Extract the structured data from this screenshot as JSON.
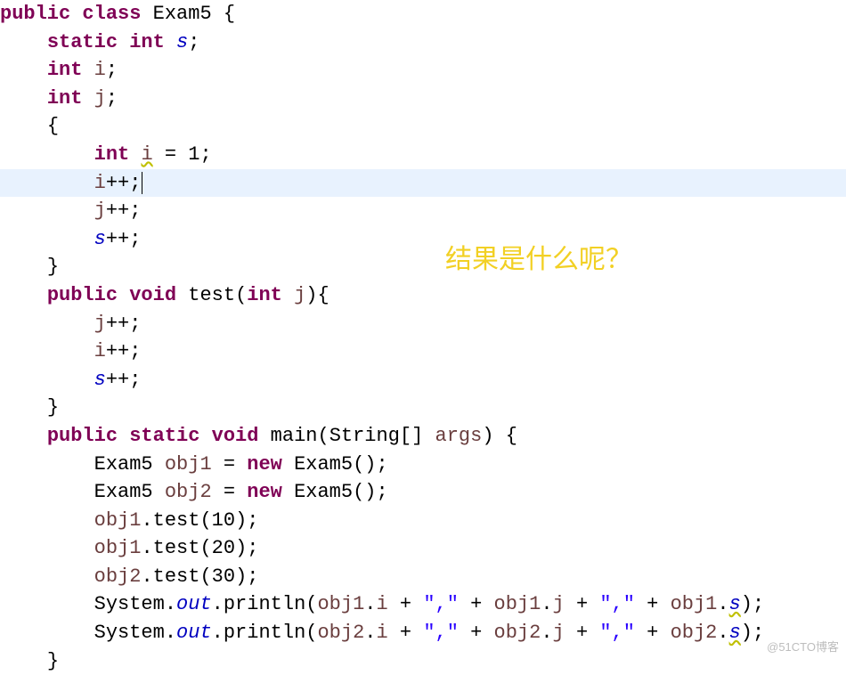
{
  "code": {
    "l1_public": "public",
    "l1_class": "class",
    "l1_name": "Exam5",
    "l2_static": "static",
    "l2_int": "int",
    "l2_s": "s",
    "l3_int": "int",
    "l3_i": "i",
    "l4_int": "int",
    "l4_j": "j",
    "l6_int": "int",
    "l6_i": "i",
    "l6_eq": "=",
    "l6_1": "1",
    "l7_i": "i",
    "l7_pp": "++",
    "l8_j": "j",
    "l8_pp": "++",
    "l9_s": "s",
    "l9_pp": "++",
    "l11_public": "public",
    "l11_void": "void",
    "l11_test": "test",
    "l11_int": "int",
    "l11_j": "j",
    "l12_j": "j",
    "l12_pp": "++",
    "l13_i": "i",
    "l13_pp": "++",
    "l14_s": "s",
    "l14_pp": "++",
    "l16_public": "public",
    "l16_static": "static",
    "l16_void": "void",
    "l16_main": "main",
    "l16_string": "String[]",
    "l16_args": "args",
    "l17_t": "Exam5",
    "l17_v": "obj1",
    "l17_new": "new",
    "l17_c": "Exam5()",
    "l18_t": "Exam5",
    "l18_v": "obj2",
    "l18_new": "new",
    "l18_c": "Exam5()",
    "l19_o": "obj1",
    "l19_m": "test",
    "l19_a": "10",
    "l20_o": "obj1",
    "l20_m": "test",
    "l20_a": "20",
    "l21_o": "obj2",
    "l21_m": "test",
    "l21_a": "30",
    "sys": "System",
    "out": "out",
    "println": "println",
    "obj1": "obj1",
    "obj2": "obj2",
    "fi": "i",
    "fj": "j",
    "fs": "s",
    "comma_str": "\",\"",
    "plus": "+"
  },
  "sym": {
    "ob": "{",
    "cb": "}",
    "op": "(",
    "cp": ")",
    "sc": ";",
    "dot": "."
  },
  "annotation": "结果是什么呢？",
  "watermark": "@51CTO博客"
}
